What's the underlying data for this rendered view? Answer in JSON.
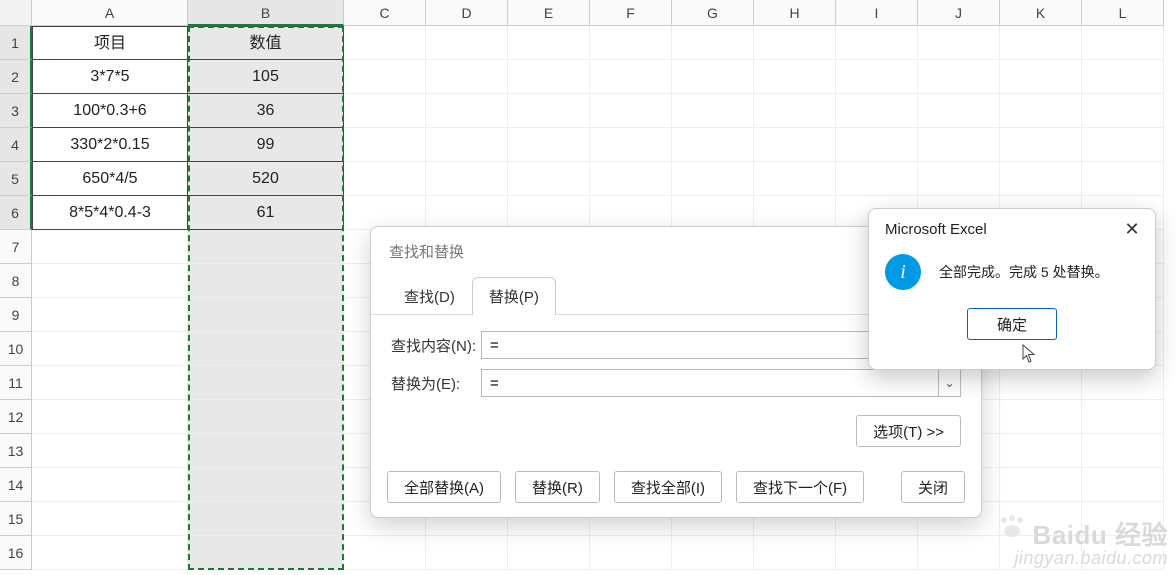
{
  "columns": [
    "A",
    "B",
    "C",
    "D",
    "E",
    "F",
    "G",
    "H",
    "I",
    "J",
    "K",
    "L"
  ],
  "row_count": 16,
  "selected_column_index": 1,
  "table": {
    "headers": {
      "A": "项目",
      "B": "数值"
    },
    "rows": [
      {
        "A": "3*7*5",
        "B": "105"
      },
      {
        "A": "100*0.3+6",
        "B": "36"
      },
      {
        "A": "330*2*0.15",
        "B": "99"
      },
      {
        "A": "650*4/5",
        "B": "520"
      },
      {
        "A": "8*5*4*0.4-3",
        "B": "61"
      }
    ]
  },
  "find_replace_dialog": {
    "title": "查找和替换",
    "tabs": {
      "find": "查找(D)",
      "replace": "替换(P)"
    },
    "active_tab": "replace",
    "find_label": "查找内容(N):",
    "find_value": "=",
    "replace_label": "替换为(E):",
    "replace_value": "=",
    "options_button": "选项(T) >>",
    "buttons": {
      "replace_all": "全部替换(A)",
      "replace": "替换(R)",
      "find_all": "查找全部(I)",
      "find_next": "查找下一个(F)",
      "close": "关闭"
    }
  },
  "message_box": {
    "title": "Microsoft Excel",
    "text": "全部完成。完成 5 处替换。",
    "ok": "确定",
    "icon": "info-icon"
  },
  "watermark": {
    "brand": "Baidu 经验",
    "url": "jingyan.baidu.com"
  }
}
